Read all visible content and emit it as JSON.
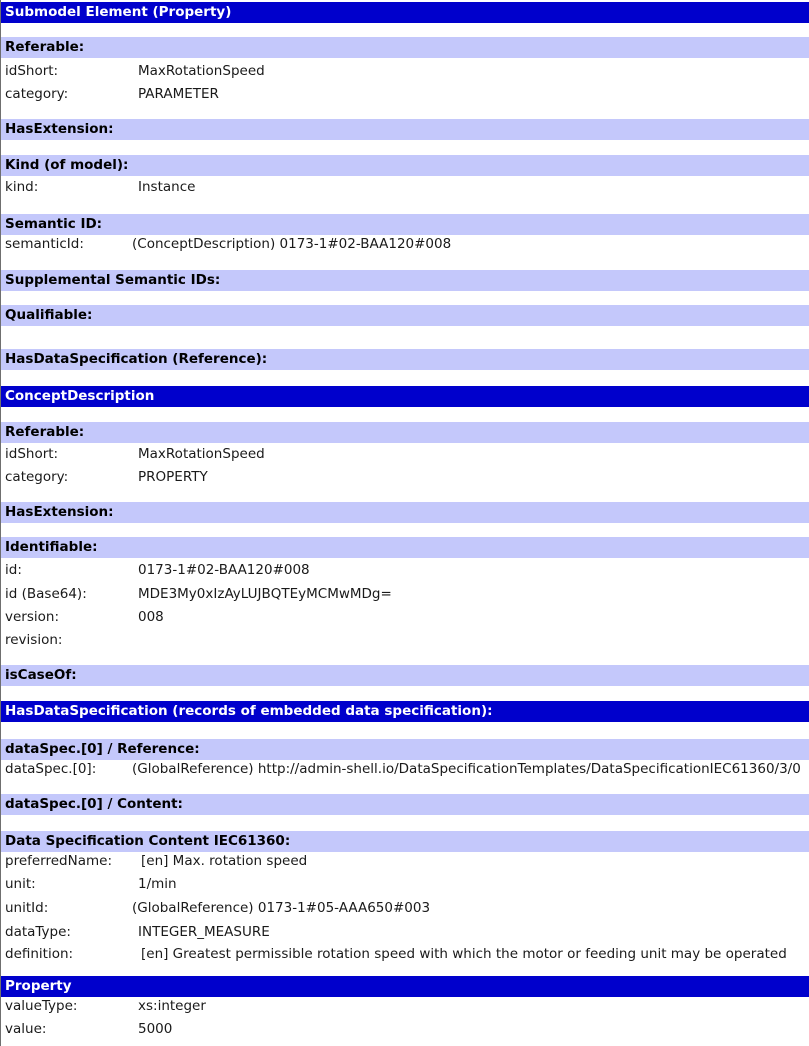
{
  "submodel_element": {
    "title": "Submodel Element (Property)",
    "referable": {
      "heading": "Referable:",
      "idShort_key": "idShort:",
      "idShort": "MaxRotationSpeed",
      "category_key": "category:",
      "category": "PARAMETER"
    },
    "has_extension": "HasExtension:",
    "kind_heading": "Kind (of model):",
    "kind_key": "kind:",
    "kind": "Instance",
    "semantic_heading": "Semantic ID:",
    "semanticId_key": "semanticId:",
    "semanticId": "(ConceptDescription) 0173-1#02-BAA120#008",
    "supplemental": "Supplemental Semantic IDs:",
    "qualifiable": "Qualifiable:",
    "has_data_spec_ref": "HasDataSpecification (Reference):"
  },
  "concept_description": {
    "title": "ConceptDescription",
    "referable": {
      "heading": "Referable:",
      "idShort_key": "idShort:",
      "idShort": "MaxRotationSpeed",
      "category_key": "category:",
      "category": "PROPERTY"
    },
    "has_extension": "HasExtension:",
    "identifiable": {
      "heading": "Identifiable:",
      "id_key": "id:",
      "id": "0173-1#02-BAA120#008",
      "id64_key": "id (Base64):",
      "id64": "MDE3My0xIzAyLUJBQTEyMCMwMDg=",
      "version_key": "version:",
      "version": "008",
      "revision_key": "revision:",
      "revision": ""
    },
    "is_case_of": "isCaseOf:"
  },
  "has_data_spec": {
    "title": "HasDataSpecification (records of embedded data specification):",
    "ref_heading": "dataSpec.[0] / Reference:",
    "ref_key": "dataSpec.[0]:",
    "ref_value": "(GlobalReference) http://admin-shell.io/DataSpecificationTemplates/DataSpecificationIEC61360/3/0",
    "content_heading": "dataSpec.[0] / Content:",
    "iec_heading": "Data Specification Content IEC61360:",
    "preferredName_key": "preferredName:",
    "preferredName": "[en] Max. rotation speed",
    "unit_key": "unit:",
    "unit": "1/min",
    "unitId_key": "unitId:",
    "unitId": "(GlobalReference) 0173-1#05-AAA650#003",
    "dataType_key": "dataType:",
    "dataType": "INTEGER_MEASURE",
    "definition_key": "definition:",
    "definition": "[en] Greatest permissible rotation speed with which the motor or feeding unit may be operated"
  },
  "property": {
    "title": "Property",
    "valueType_key": "valueType:",
    "valueType": "xs:integer",
    "value_key": "value:",
    "value": "5000"
  },
  "colors": {
    "dark_header": "#0000cc",
    "light_header": "#c4c8fb"
  }
}
